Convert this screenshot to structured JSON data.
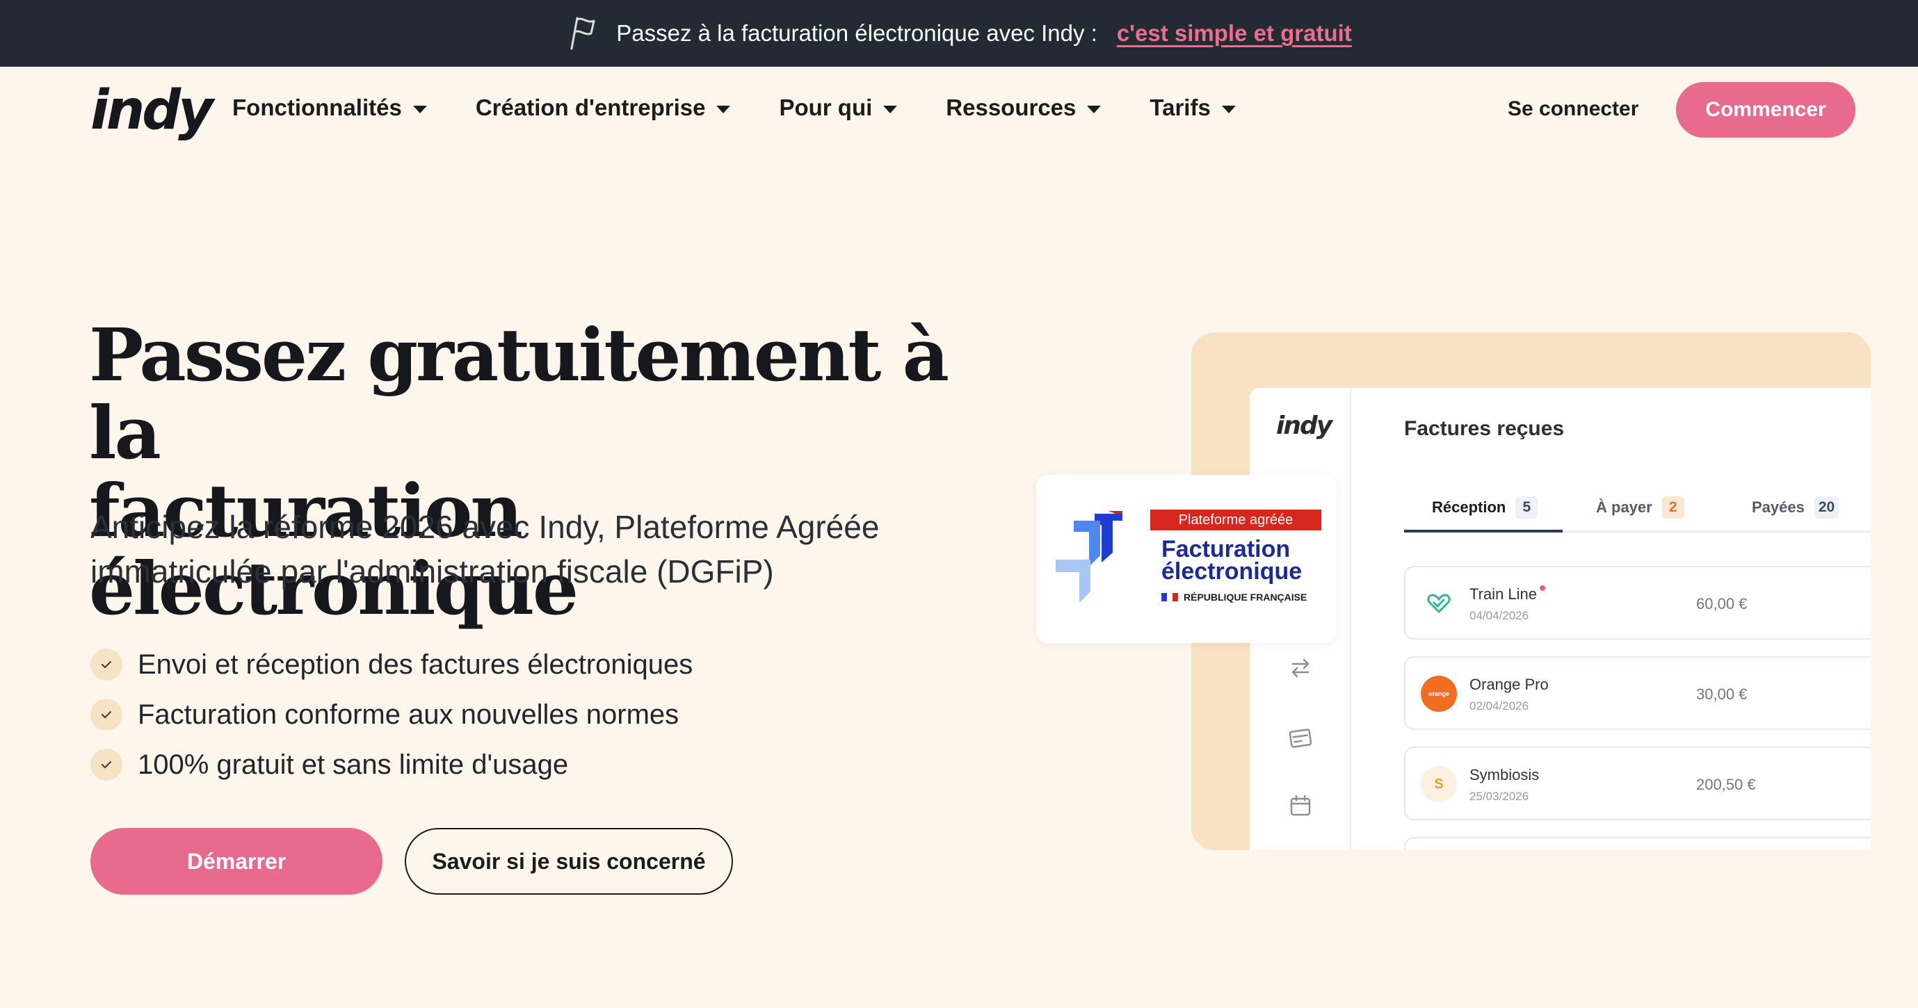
{
  "announcement": {
    "text": "Passez à la facturation électronique avec Indy :",
    "link": "c'est simple et gratuit"
  },
  "nav": {
    "logo": "indy",
    "menu": [
      {
        "label": "Fonctionnalités"
      },
      {
        "label": "Création d'entreprise"
      },
      {
        "label": "Pour qui"
      },
      {
        "label": "Ressources"
      },
      {
        "label": "Tarifs"
      }
    ],
    "login": "Se connecter",
    "cta": "Commencer"
  },
  "hero": {
    "title_line1": "Passez gratuitement à la",
    "title_line2": "facturation électronique",
    "subtitle_line1": "Anticipez la réforme 2026 avec Indy, Plateforme Agréée",
    "subtitle_line2": "immatriculée par l'administration fiscale (DGFiP)",
    "features": [
      "Envoi et réception des factures électroniques",
      "Facturation conforme aux nouvelles normes",
      "100% gratuit et sans limite d'usage"
    ],
    "primary_button": "Démarrer",
    "secondary_button": "Savoir si je suis concerné"
  },
  "badge": {
    "ribbon": "Plateforme agréée",
    "title_line1": "Facturation",
    "title_line2": "électronique",
    "footer": "RÉPUBLIQUE FRANÇAISE"
  },
  "mockup": {
    "logo": "indy",
    "title": "Factures reçues",
    "tabs": [
      {
        "label": "Réception",
        "count": "5"
      },
      {
        "label": "À payer",
        "count": "2"
      },
      {
        "label": "Payées",
        "count": "20"
      }
    ],
    "invoices": [
      {
        "name": "Train Line",
        "date": "04/04/2026",
        "amount": "60,00 €"
      },
      {
        "name": "Orange Pro",
        "date": "02/04/2026",
        "amount": "30,00 €",
        "logo_text": "orange"
      },
      {
        "name": "Symbiosis",
        "date": "25/03/2026",
        "amount": "200,50 €",
        "logo_text": "S"
      }
    ]
  },
  "colors": {
    "accent": "#e86a8c",
    "topbar": "#222a34",
    "background": "#fdf6ec",
    "mockup_frame": "#f9e2c2"
  }
}
